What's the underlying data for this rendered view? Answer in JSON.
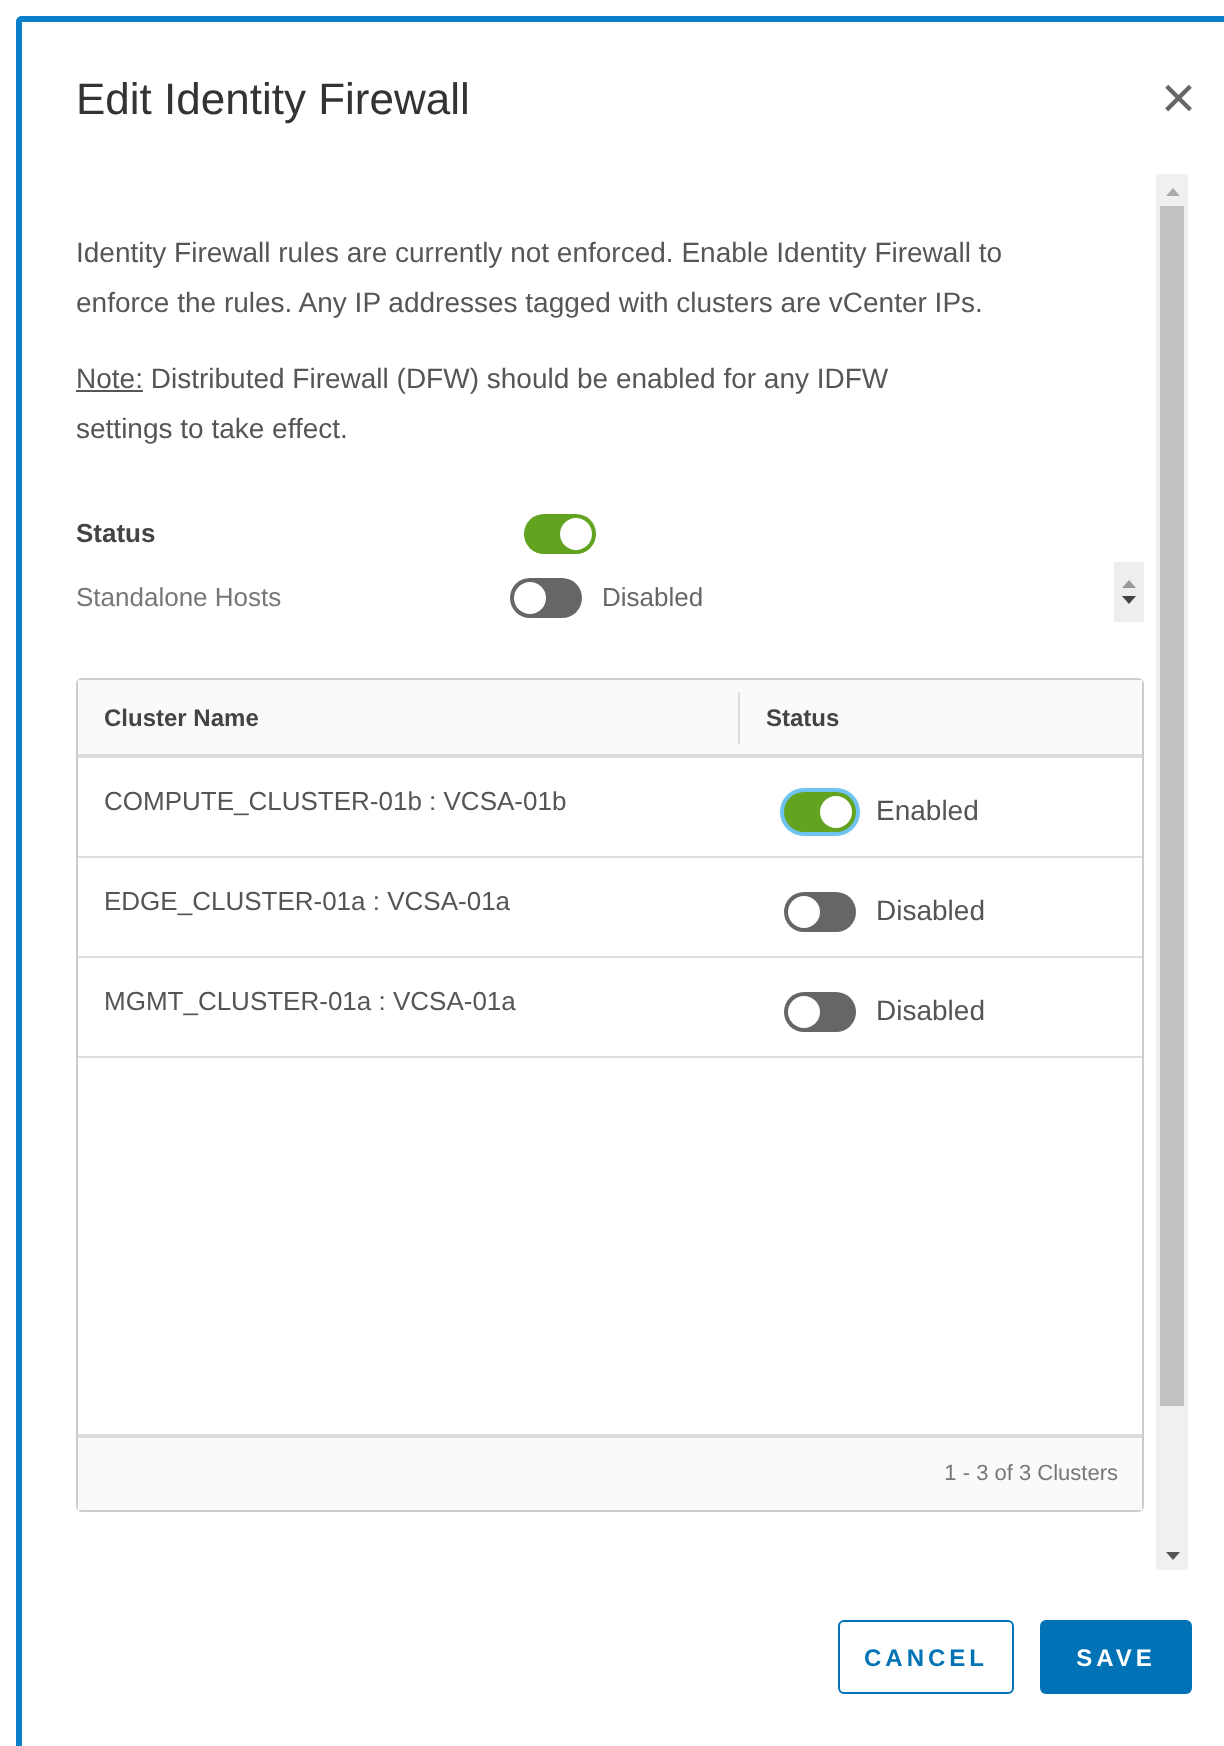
{
  "dialog": {
    "title": "Edit Identity Firewall",
    "close": "×"
  },
  "intro": "Identity Firewall rules are currently not enforced. Enable Identity Firewall to enforce the rules. Any IP addresses tagged with clusters are vCenter IPs.",
  "note": {
    "label": "Note:",
    "text": " Distributed Firewall (DFW) should be enabled for any IDFW settings to take effect."
  },
  "status": {
    "label": "Status",
    "on": true
  },
  "standalone": {
    "label": "Standalone Hosts",
    "on": false,
    "state_text": "Disabled"
  },
  "table": {
    "columns": [
      "Cluster Name",
      "Status"
    ],
    "rows": [
      {
        "name": "COMPUTE_CLUSTER-01b : VCSA-01b",
        "on": true,
        "focused": true,
        "state_text": "Enabled"
      },
      {
        "name": "EDGE_CLUSTER-01a : VCSA-01a",
        "on": false,
        "focused": false,
        "state_text": "Disabled"
      },
      {
        "name": "MGMT_CLUSTER-01a : VCSA-01a",
        "on": false,
        "focused": false,
        "state_text": "Disabled"
      }
    ],
    "footer": "1 - 3 of 3 Clusters"
  },
  "buttons": [
    {
      "label": "CANCEL",
      "kind": "secondary"
    },
    {
      "label": "SAVE",
      "kind": "primary"
    }
  ]
}
